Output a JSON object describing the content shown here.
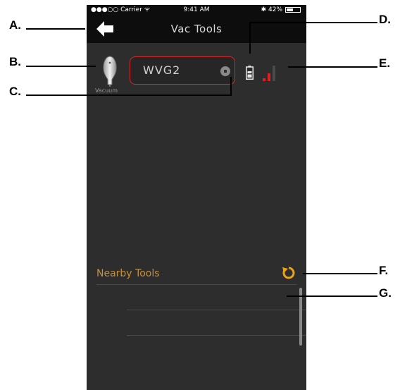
{
  "status_bar": {
    "carrier": "●●●○○ Carrier ᯤ",
    "time": "9:41 AM",
    "battery_text": "✱ 42%"
  },
  "nav": {
    "title": "Vac Tools"
  },
  "tool": {
    "label": "Vacuum",
    "field_value": "WVG2"
  },
  "section": {
    "title": "Nearby Tools"
  },
  "callouts": {
    "a": "A.",
    "b": "B.",
    "c": "C.",
    "d": "D.",
    "e": "E.",
    "f": "F.",
    "g": "G."
  },
  "colors": {
    "screen_bg": "#2d2d2d",
    "bar_bg": "#0d0d0d",
    "field_border": "#d02a2a",
    "accent": "#e9a21e",
    "signal_active": "#e02020"
  },
  "icons": {
    "back": "back-arrow-icon",
    "vacuum": "vacuum-tool-icon",
    "clear": "clear-icon",
    "battery": "battery-icon",
    "signal": "signal-strength-icon",
    "refresh": "refresh-icon"
  }
}
